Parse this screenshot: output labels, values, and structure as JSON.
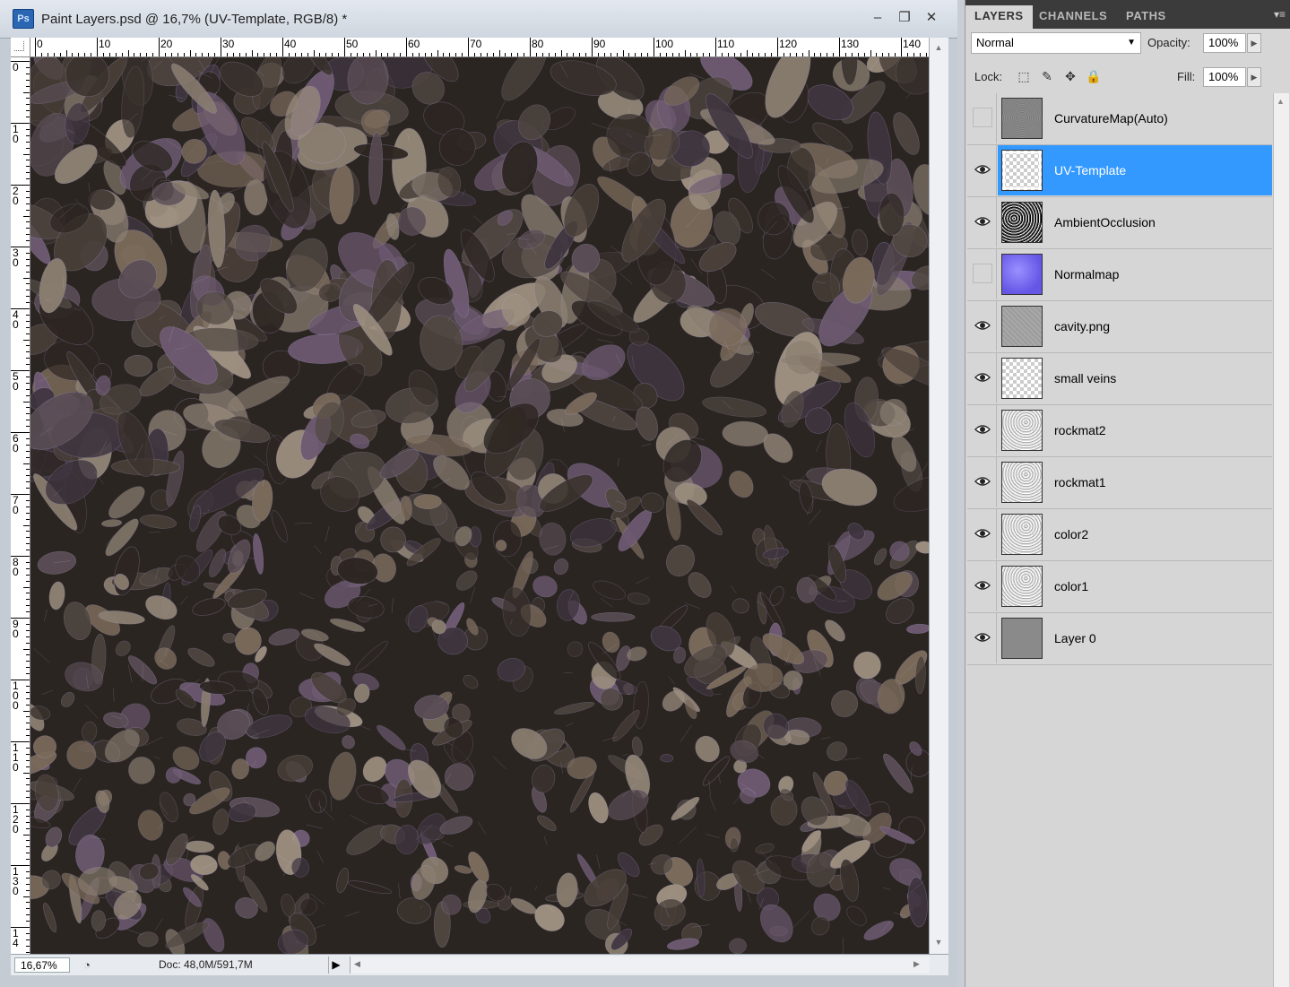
{
  "document": {
    "title": "Paint Layers.psd @ 16,7% (UV-Template, RGB/8) *",
    "app_icon": "Ps",
    "window_buttons": {
      "minimize": "–",
      "maximize": "❐",
      "close": "✕"
    },
    "ruler_h_labels": [
      "0",
      "10",
      "20",
      "30",
      "40",
      "50",
      "60",
      "70",
      "80",
      "90",
      "100",
      "110",
      "120",
      "130",
      "140"
    ],
    "ruler_v_labels": [
      "0",
      "10",
      "20",
      "30",
      "40",
      "50",
      "60",
      "70",
      "80",
      "90",
      "100",
      "110",
      "120",
      "130",
      "14"
    ],
    "zoom": "16,67%",
    "doc_size": "Doc: 48,0M/591,7M"
  },
  "layers_panel": {
    "tabs": [
      {
        "label": "LAYERS",
        "active": true
      },
      {
        "label": "CHANNELS",
        "active": false
      },
      {
        "label": "PATHS",
        "active": false
      }
    ],
    "blend_mode": "Normal",
    "opacity_label": "Opacity:",
    "opacity_value": "100%",
    "lock_label": "Lock:",
    "fill_label": "Fill:",
    "fill_value": "100%",
    "layers": [
      {
        "name": "CurvatureMap(Auto)",
        "visible": false,
        "selected": false,
        "thumb": "gray-noise"
      },
      {
        "name": "UV-Template",
        "visible": true,
        "selected": true,
        "thumb": "checker"
      },
      {
        "name": "AmbientOcclusion",
        "visible": true,
        "selected": false,
        "thumb": "noise-dark"
      },
      {
        "name": "Normalmap",
        "visible": false,
        "selected": false,
        "thumb": "normal-map"
      },
      {
        "name": "cavity.png",
        "visible": true,
        "selected": false,
        "thumb": "cavity"
      },
      {
        "name": "small veins",
        "visible": true,
        "selected": false,
        "thumb": "checker"
      },
      {
        "name": "rockmat2",
        "visible": true,
        "selected": false,
        "thumb": "noise-light"
      },
      {
        "name": "rockmat1",
        "visible": true,
        "selected": false,
        "thumb": "noise-light"
      },
      {
        "name": "color2",
        "visible": true,
        "selected": false,
        "thumb": "noise-light"
      },
      {
        "name": "color1",
        "visible": true,
        "selected": false,
        "thumb": "noise-light"
      },
      {
        "name": "Layer 0",
        "visible": true,
        "selected": false,
        "thumb": "gray"
      }
    ]
  }
}
